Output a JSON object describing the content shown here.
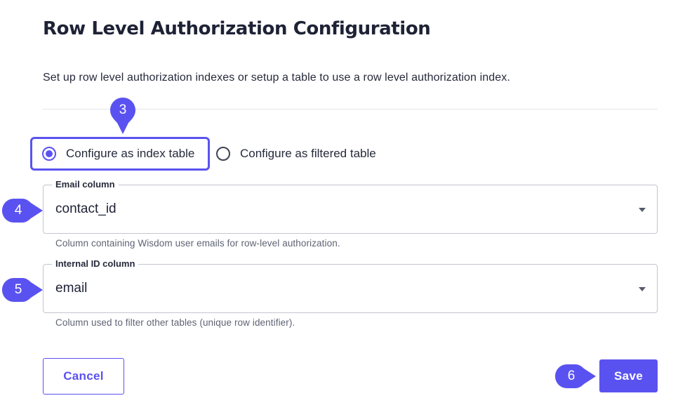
{
  "header": {
    "title": "Row Level Authorization Configuration",
    "subtitle": "Set up row level authorization indexes or setup a table to use a row level authorization index."
  },
  "radio": {
    "options": [
      {
        "label": "Configure as index table",
        "selected": true
      },
      {
        "label": "Configure as filtered table",
        "selected": false
      }
    ]
  },
  "fields": {
    "email": {
      "label": "Email column",
      "value": "contact_id",
      "helper": "Column containing Wisdom user emails for row-level authorization."
    },
    "internal_id": {
      "label": "Internal ID column",
      "value": "email",
      "helper": "Column used to filter other tables (unique row identifier)."
    }
  },
  "actions": {
    "cancel_label": "Cancel",
    "save_label": "Save"
  },
  "markers": [
    "3",
    "4",
    "5",
    "6"
  ],
  "colors": {
    "accent": "#5a52f0",
    "text": "#1e2235",
    "border": "#c4c6cf",
    "helper": "#5f6373"
  }
}
